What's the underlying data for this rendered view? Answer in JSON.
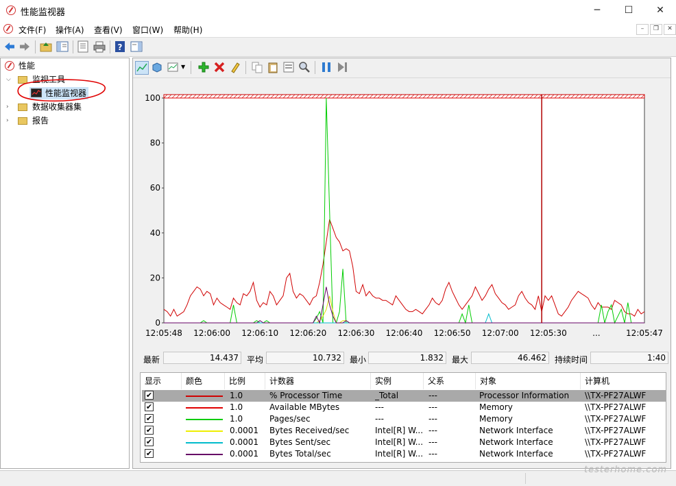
{
  "window": {
    "title": "性能监视器",
    "minimize": "─",
    "maximize": "☐",
    "close": "✕"
  },
  "menu": [
    "文件(F)",
    "操作(A)",
    "查看(V)",
    "窗口(W)",
    "帮助(H)"
  ],
  "mdi": {
    "minimize": "–",
    "restore": "❐",
    "close": "✕"
  },
  "toolbar_icons": [
    "back-icon",
    "forward-icon",
    "up-folder-icon",
    "show-hide-tree-icon",
    "properties-icon",
    "print-icon",
    "help-icon",
    "action-pane-icon"
  ],
  "tree": {
    "root": "性能",
    "monitor_tools": "监视工具",
    "perf_monitor": "性能监视器",
    "data_collector_sets": "数据收集器集",
    "reports": "报告"
  },
  "chart_toolbar_icons": [
    "view-graph-icon",
    "change-graph-type-icon",
    "freeze-display-icon",
    "add-counter-icon",
    "delete-counter-icon",
    "highlight-icon",
    "copy-properties-icon",
    "paste-counter-icon",
    "properties-icon",
    "zoom-icon",
    "pause-icon",
    "update-data-icon"
  ],
  "chart_data": {
    "type": "line",
    "ylim": [
      0,
      100
    ],
    "yticks": [
      "100",
      "80",
      "60",
      "40",
      "20",
      "0"
    ],
    "xticks": [
      "12:05:48",
      "12:06:00",
      "12:06:10",
      "12:06:20",
      "12:06:30",
      "12:06:40",
      "12:06:50",
      "12:07:00",
      "12:05:30",
      "...",
      "12:05:47"
    ],
    "grid": false,
    "series": [
      {
        "name": "% Processor Time",
        "color": "#d00000",
        "values": [
          6,
          5,
          3,
          6,
          3,
          4,
          5,
          8,
          12,
          14,
          16,
          15,
          12,
          14,
          13,
          8,
          11,
          9,
          8,
          7,
          6,
          11,
          9,
          8,
          13,
          12,
          14,
          18,
          10,
          7,
          9,
          8,
          14,
          12,
          8,
          10,
          12,
          20,
          22,
          14,
          11,
          13,
          12,
          10,
          8,
          11,
          12,
          18,
          26,
          36,
          46,
          42,
          38,
          36,
          32,
          33,
          32,
          25,
          14,
          13,
          17,
          12,
          14,
          12,
          11,
          11,
          10,
          10,
          9,
          8,
          12,
          10,
          8,
          6,
          5,
          5,
          6,
          5,
          4,
          6,
          8,
          11,
          9,
          8,
          10,
          15,
          18,
          14,
          11,
          8,
          6,
          8,
          10,
          12,
          16,
          13,
          10,
          12,
          15,
          17,
          13,
          11,
          9,
          8,
          6,
          7,
          8,
          12,
          14,
          11,
          9,
          8,
          6,
          12,
          5,
          12,
          10,
          12,
          8,
          4,
          3,
          5,
          7,
          10,
          12,
          14,
          13,
          12,
          11,
          8,
          6,
          9,
          7,
          7,
          7,
          6,
          10,
          9,
          8,
          5,
          4,
          4,
          3,
          6,
          4,
          5
        ]
      },
      {
        "name": "Available MBytes",
        "color": "#e00000",
        "values": [
          101,
          101,
          101,
          101,
          101,
          101,
          101,
          101,
          101,
          101,
          101,
          101,
          101,
          101,
          101,
          101,
          101,
          101,
          101,
          101,
          101,
          101,
          101,
          101,
          101,
          101,
          101,
          101,
          101,
          101,
          101,
          101,
          101,
          101,
          101,
          101,
          101,
          101,
          101,
          101,
          101,
          101,
          101,
          101,
          101,
          101,
          101,
          101,
          101,
          101,
          101,
          101,
          101,
          101,
          101,
          101,
          101,
          101,
          101,
          101,
          101,
          101,
          101,
          101,
          101,
          101,
          101,
          101,
          101,
          101,
          101,
          101,
          101,
          101,
          101,
          101,
          101,
          101,
          101,
          101,
          101,
          101,
          101,
          101,
          101,
          101,
          101,
          101,
          101,
          101,
          101,
          101,
          101,
          101,
          101,
          101,
          101,
          101,
          101,
          101,
          101,
          101,
          101,
          101,
          101,
          101,
          101,
          101,
          101,
          101,
          101,
          101,
          101,
          101,
          101,
          101,
          101,
          101,
          101,
          101,
          101,
          101,
          101,
          101,
          101,
          101,
          101,
          101,
          101,
          101,
          101,
          101,
          101,
          101,
          101,
          101,
          101,
          101,
          101,
          101,
          101,
          101,
          101,
          101,
          101,
          101
        ]
      },
      {
        "name": "Pages/sec",
        "color": "#00cc00",
        "values": [
          0,
          0,
          0,
          0,
          0,
          0,
          0,
          0,
          0,
          0,
          0,
          0,
          1,
          0,
          0,
          0,
          0,
          0,
          0,
          0,
          0,
          8,
          0,
          0,
          0,
          0,
          0,
          0,
          1,
          0,
          0,
          1,
          0,
          0,
          0,
          0,
          0,
          0,
          0,
          0,
          0,
          0,
          0,
          0,
          0,
          0,
          2,
          5,
          0,
          100,
          50,
          0,
          0,
          5,
          24,
          0,
          0,
          0,
          0,
          0,
          0,
          0,
          0,
          0,
          0,
          0,
          0,
          0,
          0,
          0,
          0,
          0,
          0,
          0,
          0,
          0,
          0,
          0,
          0,
          0,
          0,
          0,
          0,
          0,
          0,
          0,
          0,
          0,
          0,
          0,
          4,
          0,
          8,
          0,
          0,
          0,
          0,
          0,
          0,
          0,
          0,
          0,
          0,
          0,
          0,
          0,
          0,
          0,
          0,
          0,
          0,
          0,
          0,
          0,
          0,
          0,
          0,
          0,
          0,
          0,
          0,
          0,
          0,
          0,
          0,
          0,
          0,
          0,
          0,
          0,
          0,
          0,
          8,
          0,
          5,
          8,
          0,
          3,
          6,
          0,
          9,
          0,
          0,
          0,
          0,
          0
        ]
      },
      {
        "name": "Bytes Received/sec",
        "color": "#dddd00",
        "values": [
          0,
          0,
          0,
          0,
          0,
          0,
          0,
          0,
          0,
          0,
          0,
          0,
          0,
          0,
          0,
          0,
          0,
          0,
          0,
          0,
          0,
          0,
          0,
          0,
          0,
          0,
          0,
          0,
          0,
          0,
          0,
          0,
          0,
          0,
          0,
          0,
          0,
          0,
          0,
          0,
          0,
          0,
          0,
          0,
          0,
          0,
          0,
          1,
          3,
          6,
          12,
          5,
          0,
          0,
          1,
          1,
          0,
          0,
          0,
          0,
          0,
          0,
          0,
          0,
          0,
          0,
          0,
          0,
          0,
          0,
          0,
          0,
          0,
          0,
          0,
          0,
          0,
          0,
          0,
          0,
          0,
          0,
          0,
          0,
          0,
          0,
          0,
          0,
          0,
          0,
          0,
          0,
          0,
          0,
          0,
          0,
          0,
          0,
          0,
          0,
          0,
          0,
          0,
          0,
          0,
          0,
          0,
          0,
          0,
          0,
          0,
          0,
          0,
          0,
          0,
          0,
          0,
          0,
          0,
          0,
          0,
          0,
          0,
          0,
          0,
          0,
          0,
          0,
          0,
          0,
          0,
          0,
          0,
          0,
          0,
          0,
          0,
          0,
          0,
          0,
          0,
          0,
          0,
          0,
          0,
          0
        ]
      },
      {
        "name": "Bytes Sent/sec",
        "color": "#00bbcc",
        "values": [
          0,
          0,
          0,
          0,
          0,
          0,
          0,
          0,
          0,
          0,
          0,
          0,
          0,
          0,
          0,
          0,
          0,
          0,
          0,
          0,
          0,
          0,
          0,
          0,
          0,
          0,
          0,
          0,
          0,
          0,
          0,
          0,
          0,
          0,
          0,
          0,
          0,
          0,
          0,
          0,
          0,
          0,
          0,
          0,
          0,
          0,
          0,
          0,
          0,
          0,
          0,
          0,
          0,
          0,
          0,
          0,
          0,
          0,
          0,
          0,
          0,
          0,
          0,
          0,
          0,
          0,
          0,
          0,
          0,
          0,
          0,
          0,
          0,
          0,
          0,
          0,
          0,
          0,
          0,
          0,
          0,
          0,
          0,
          0,
          0,
          0,
          0,
          0,
          0,
          0,
          0,
          0,
          0,
          0,
          0,
          0,
          0,
          0,
          4,
          0,
          0,
          0,
          0,
          0,
          0,
          0,
          0,
          0,
          0,
          0,
          0,
          0,
          0,
          0,
          0,
          0,
          0,
          0,
          0,
          0,
          0,
          0,
          0,
          0,
          0,
          0,
          0,
          0,
          0,
          0,
          0,
          0,
          0,
          0,
          0,
          0,
          0,
          0,
          0,
          0,
          0,
          0,
          0,
          0,
          0,
          0
        ]
      },
      {
        "name": "Bytes Total/sec",
        "color": "#660066",
        "values": [
          0,
          0,
          0,
          0,
          0,
          0,
          0,
          0,
          0,
          0,
          0,
          0,
          0,
          0,
          0,
          0,
          0,
          0,
          0,
          0,
          0,
          0,
          0,
          0,
          0,
          0,
          0,
          0,
          0,
          1,
          0,
          0,
          0,
          0,
          0,
          0,
          0,
          0,
          0,
          0,
          0,
          0,
          0,
          0,
          0,
          0,
          3,
          0,
          8,
          16,
          8,
          3,
          0,
          0,
          0,
          1,
          0,
          0,
          0,
          0,
          0,
          0,
          0,
          0,
          0,
          0,
          0,
          0,
          0,
          0,
          0,
          0,
          0,
          0,
          0,
          0,
          0,
          0,
          0,
          0,
          0,
          0,
          0,
          0,
          0,
          0,
          0,
          0,
          0,
          0,
          0,
          0,
          0,
          0,
          0,
          0,
          0,
          0,
          0,
          0,
          0,
          0,
          0,
          0,
          0,
          0,
          0,
          0,
          0,
          0,
          0,
          0,
          0,
          0,
          0,
          0,
          0,
          0,
          0,
          0,
          0,
          0,
          0,
          0,
          0,
          0,
          0,
          0,
          0,
          0,
          0,
          0,
          0,
          0,
          0,
          0,
          0,
          0,
          0,
          0,
          0,
          0,
          0,
          0,
          0,
          0
        ]
      }
    ],
    "cursor_index": 114
  },
  "stats": {
    "last_label": "最新",
    "last": "14.437",
    "avg_label": "平均",
    "avg": "10.732",
    "min_label": "最小",
    "min": "1.832",
    "max_label": "最大",
    "max": "46.462",
    "dur_label": "持续时间",
    "dur": "1:40"
  },
  "legend": {
    "headers": [
      "显示",
      "颜色",
      "比例",
      "计数器",
      "实例",
      "父系",
      "对象",
      "计算机"
    ],
    "rows": [
      {
        "show": "✔",
        "color": "#d00000",
        "scale": "1.0",
        "counter": "% Processor Time",
        "instance": "_Total",
        "parent": "---",
        "object": "Processor Information",
        "computer": "\\\\TX-PF27ALWF"
      },
      {
        "show": "✔",
        "color": "#e00000",
        "scale": "1.0",
        "counter": "Available MBytes",
        "instance": "---",
        "parent": "---",
        "object": "Memory",
        "computer": "\\\\TX-PF27ALWF"
      },
      {
        "show": "✔",
        "color": "#00cc00",
        "scale": "1.0",
        "counter": "Pages/sec",
        "instance": "---",
        "parent": "---",
        "object": "Memory",
        "computer": "\\\\TX-PF27ALWF"
      },
      {
        "show": "✔",
        "color": "#eeee00",
        "scale": "0.0001",
        "counter": "Bytes Received/sec",
        "instance": "Intel[R] W...",
        "parent": "---",
        "object": "Network Interface",
        "computer": "\\\\TX-PF27ALWF"
      },
      {
        "show": "✔",
        "color": "#00bbcc",
        "scale": "0.0001",
        "counter": "Bytes Sent/sec",
        "instance": "Intel[R] W...",
        "parent": "---",
        "object": "Network Interface",
        "computer": "\\\\TX-PF27ALWF"
      },
      {
        "show": "✔",
        "color": "#660066",
        "scale": "0.0001",
        "counter": "Bytes Total/sec",
        "instance": "Intel[R] W...",
        "parent": "---",
        "object": "Network Interface",
        "computer": "\\\\TX-PF27ALWF"
      }
    ]
  },
  "watermark": "testerhome.com"
}
